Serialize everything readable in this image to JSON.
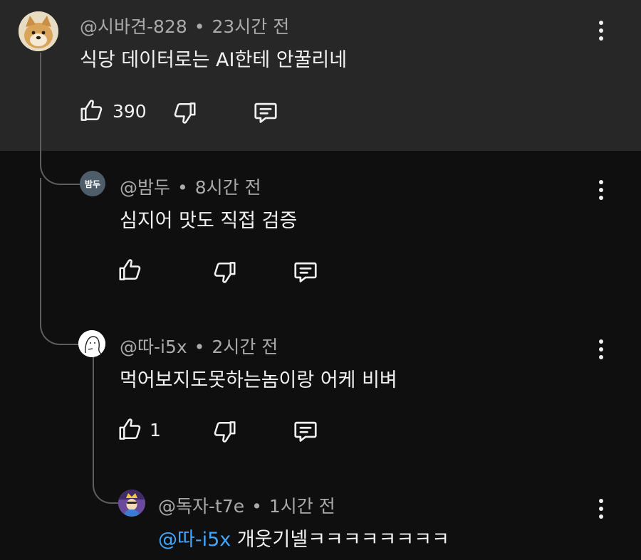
{
  "comments": [
    {
      "author": "@시바견-828",
      "time": "23시간 전",
      "text": "식당 데이터로는 AI한테 안꿀리네",
      "likes": "390"
    },
    {
      "author": "@밤두",
      "avatar_text": "밤두",
      "time": "8시간 전",
      "text": "심지어 맛도 직접 검증",
      "likes": ""
    },
    {
      "author": "@따-i5x",
      "time": "2시간 전",
      "text": "먹어보지도못하는놈이랑 어케 비벼",
      "likes": "1"
    },
    {
      "author": "@독자-t7e",
      "time": "1시간 전",
      "mention": "@따-i5x",
      "text": " 개웃기넬ㅋㅋㅋㅋㅋㅋㅋㅋ",
      "likes": ""
    }
  ],
  "separator": "•",
  "icons": [
    "like-icon",
    "dislike-icon",
    "reply-icon",
    "more-vert-icon"
  ],
  "colors": {
    "highlight_bg": "#272727",
    "background": "#0f0f0f",
    "mention": "#3ea6ff",
    "meta_text": "#aaaaaa"
  }
}
